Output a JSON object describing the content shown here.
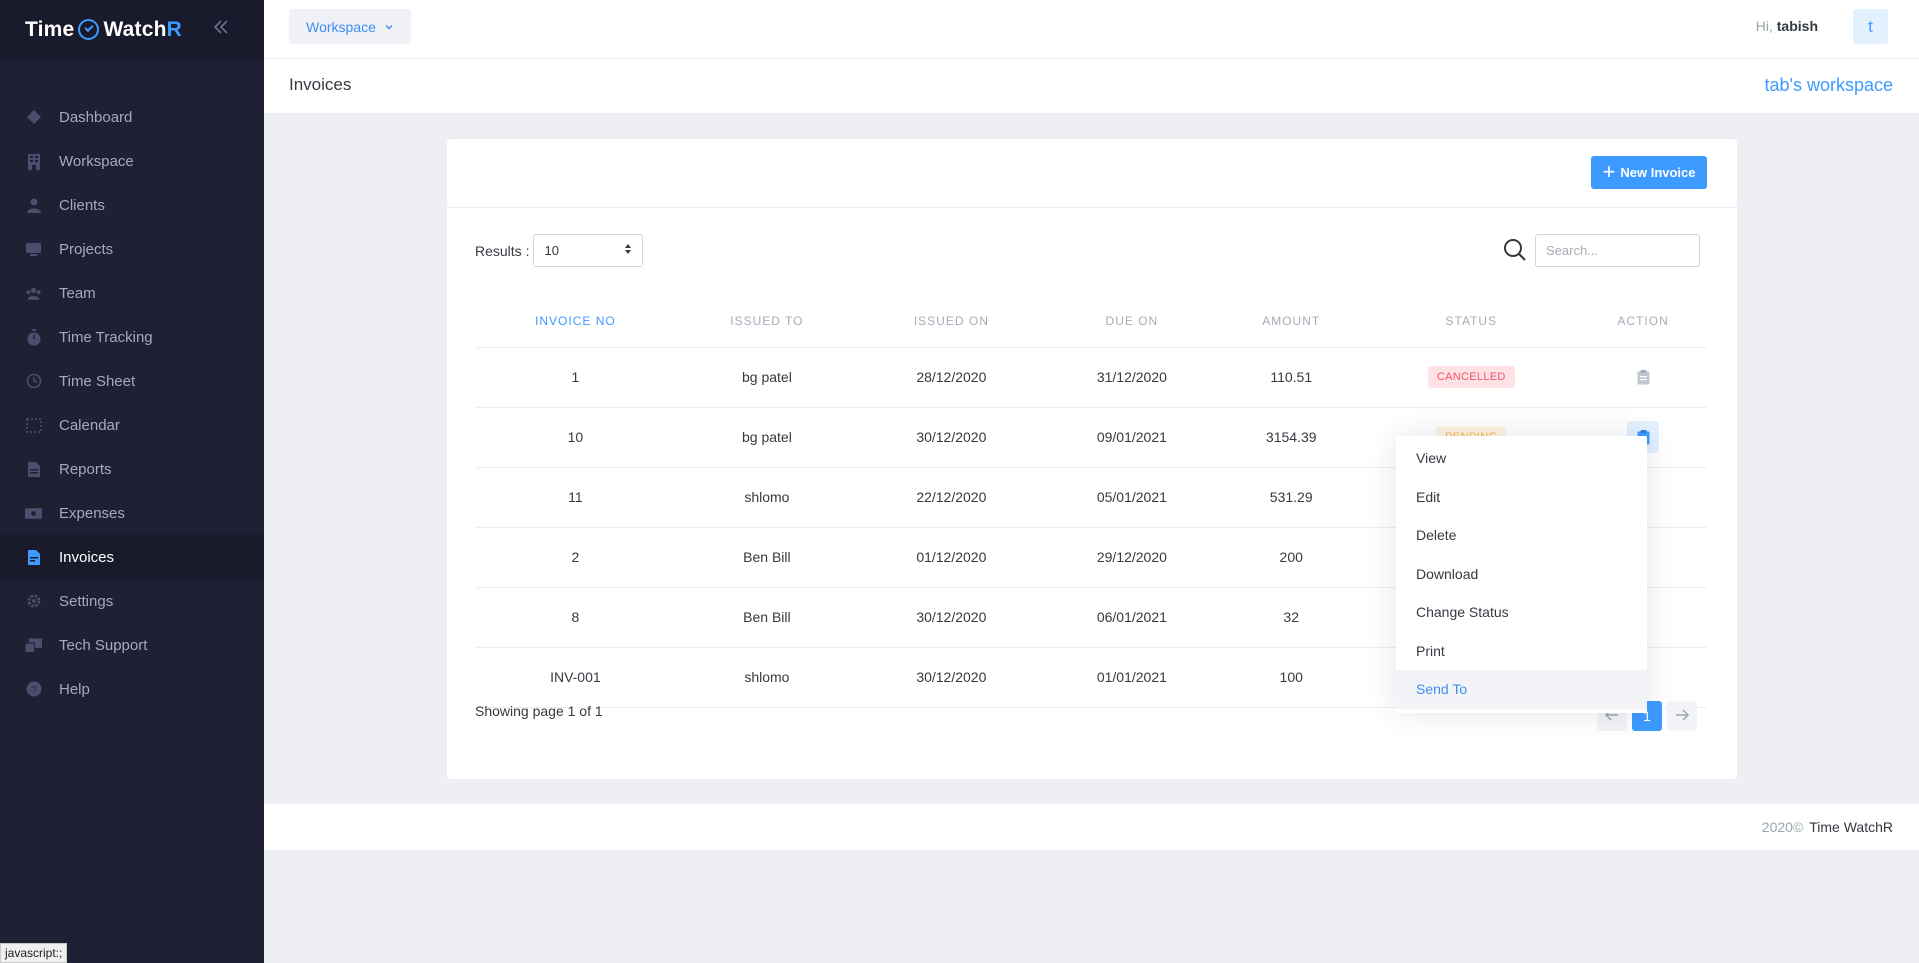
{
  "app": {
    "logo_time": "Time",
    "logo_watch": "Watch",
    "logo_r": "R"
  },
  "sidebar": {
    "items": [
      {
        "label": "Dashboard",
        "icon": "dashboard-icon"
      },
      {
        "label": "Workspace",
        "icon": "building-icon"
      },
      {
        "label": "Clients",
        "icon": "user-icon"
      },
      {
        "label": "Projects",
        "icon": "monitor-icon"
      },
      {
        "label": "Team",
        "icon": "team-icon"
      },
      {
        "label": "Time Tracking",
        "icon": "stopwatch-icon"
      },
      {
        "label": "Time Sheet",
        "icon": "clock-icon"
      },
      {
        "label": "Calendar",
        "icon": "calendar-icon"
      },
      {
        "label": "Reports",
        "icon": "document-icon"
      },
      {
        "label": "Expenses",
        "icon": "money-icon"
      },
      {
        "label": "Invoices",
        "icon": "invoice-icon",
        "active": true
      },
      {
        "label": "Settings",
        "icon": "gear-icon"
      },
      {
        "label": "Tech Support",
        "icon": "support-icon"
      },
      {
        "label": "Help",
        "icon": "help-icon"
      }
    ]
  },
  "header": {
    "workspace_button": "Workspace",
    "greeting": "Hi,",
    "username": "tabish",
    "avatar_letter": "t"
  },
  "titlebar": {
    "title": "Invoices",
    "workspace_name": "tab's workspace"
  },
  "card": {
    "new_invoice_label": "New Invoice",
    "results_label": "Results :",
    "results_value": "10",
    "search_placeholder": "Search...",
    "columns": [
      "INVOICE NO",
      "ISSUED TO",
      "ISSUED ON",
      "DUE ON",
      "AMOUNT",
      "STATUS",
      "ACTION"
    ],
    "rows": [
      {
        "no": "1",
        "issued_to": "bg patel",
        "issued_on": "28/12/2020",
        "due_on": "31/12/2020",
        "amount": "110.51",
        "status": "CANCELLED"
      },
      {
        "no": "10",
        "issued_to": "bg patel",
        "issued_on": "30/12/2020",
        "due_on": "09/01/2021",
        "amount": "3154.39",
        "status": "PENDING"
      },
      {
        "no": "11",
        "issued_to": "shlomo",
        "issued_on": "22/12/2020",
        "due_on": "05/01/2021",
        "amount": "531.29",
        "status": ""
      },
      {
        "no": "2",
        "issued_to": "Ben Bill",
        "issued_on": "01/12/2020",
        "due_on": "29/12/2020",
        "amount": "200",
        "status": ""
      },
      {
        "no": "8",
        "issued_to": "Ben Bill",
        "issued_on": "30/12/2020",
        "due_on": "06/01/2021",
        "amount": "32",
        "status": ""
      },
      {
        "no": "INV-001",
        "issued_to": "shlomo",
        "issued_on": "30/12/2020",
        "due_on": "01/01/2021",
        "amount": "100",
        "status": ""
      }
    ],
    "showing": "Showing page 1 of 1",
    "current_page": "1"
  },
  "action_menu": {
    "items": [
      "View",
      "Edit",
      "Delete",
      "Download",
      "Change Status",
      "Print",
      "Send To"
    ]
  },
  "footer": {
    "year": "2020©",
    "brand": "Time WatchR"
  },
  "status_bar": "javascript:;",
  "colors": {
    "accent": "#3d9bff",
    "sidebar_bg": "#1f2033",
    "cancelled": "#f1556c",
    "pending": "#f7b84b"
  }
}
